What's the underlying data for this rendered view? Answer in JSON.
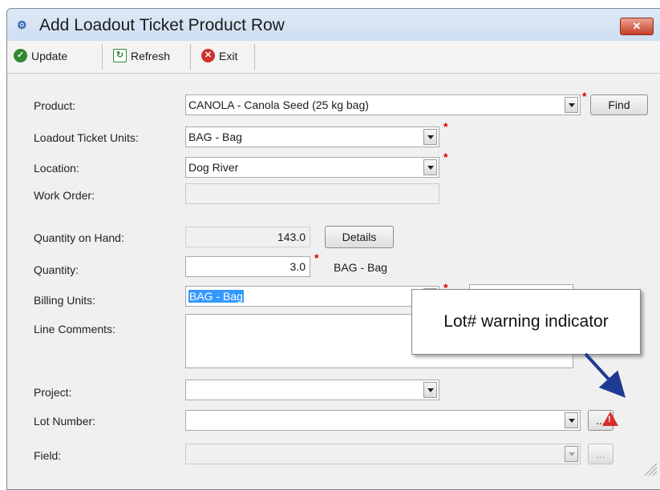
{
  "window": {
    "title": "Add Loadout Ticket Product Row",
    "close_symbol": "✕"
  },
  "toolbar": {
    "update_label": "Update",
    "refresh_label": "Refresh",
    "exit_label": "Exit"
  },
  "form": {
    "product_label": "Product:",
    "product_value": "CANOLA - Canola Seed (25 kg bag)",
    "find_label": "Find",
    "units_label": "Loadout Ticket Units:",
    "units_value": "BAG - Bag",
    "location_label": "Location:",
    "location_value": "Dog River",
    "work_order_label": "Work Order:",
    "work_order_value": "",
    "qoh_label": "Quantity on Hand:",
    "qoh_value": "143.0",
    "details_label": "Details",
    "quantity_label": "Quantity:",
    "quantity_value": "3.0",
    "quantity_units": "BAG - Bag",
    "billing_units_label": "Billing Units:",
    "billing_units_value": "BAG - Bag",
    "line_comments_label": "Line Comments:",
    "line_comments_value": "",
    "project_label": "Project:",
    "project_value": "",
    "lot_number_label": "Lot Number:",
    "lot_number_value": "",
    "lot_browse_label": "...",
    "field_label": "Field:",
    "field_value": "",
    "field_browse_label": "...",
    "required_marker": "*"
  },
  "annotation": {
    "callout_text": "Lot# warning indicator",
    "warning_symbol": "!"
  },
  "colors": {
    "required": "#d40000",
    "warning": "#d82c2c",
    "selection": "#3399ff",
    "arrow": "#1f3a93"
  }
}
